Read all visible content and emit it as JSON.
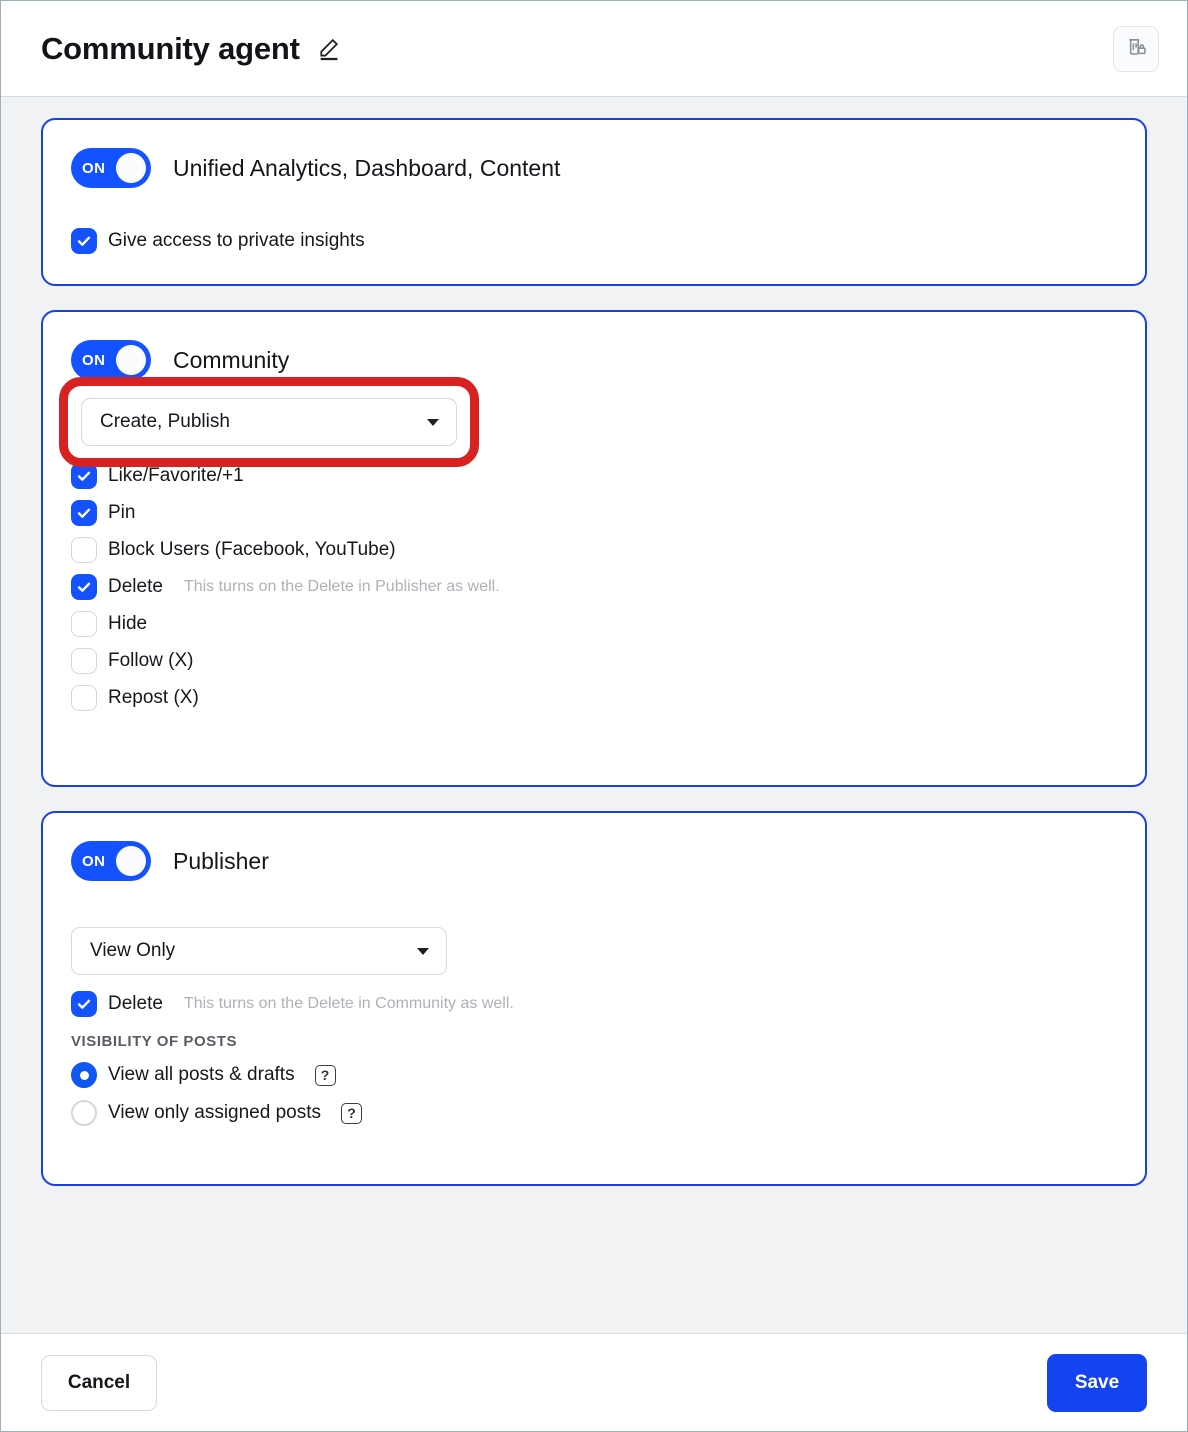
{
  "header": {
    "title": "Community agent",
    "edit_icon": "pencil-icon",
    "delete_icon": "trash-lock-icon"
  },
  "sections": [
    {
      "key": "analytics",
      "toggle_label": "ON",
      "title": "Unified Analytics, Dashboard, Content",
      "checkboxes": [
        {
          "label": "Give access to private insights",
          "checked": true,
          "hint": ""
        }
      ]
    },
    {
      "key": "community",
      "toggle_label": "ON",
      "title": "Community",
      "dropdown": {
        "value": "Create, Publish",
        "caret": "chevron-down-icon",
        "highlighted": true
      },
      "checkboxes": [
        {
          "label": "Like/Favorite/+1",
          "checked": true,
          "hint": ""
        },
        {
          "label": "Pin",
          "checked": true,
          "hint": ""
        },
        {
          "label": "Block Users (Facebook, YouTube)",
          "checked": false,
          "hint": ""
        },
        {
          "label": "Delete",
          "checked": true,
          "hint": "This turns on the Delete in Publisher as well."
        },
        {
          "label": "Hide",
          "checked": false,
          "hint": ""
        },
        {
          "label": "Follow (X)",
          "checked": false,
          "hint": ""
        },
        {
          "label": "Repost (X)",
          "checked": false,
          "hint": ""
        }
      ]
    },
    {
      "key": "publisher",
      "toggle_label": "ON",
      "title": "Publisher",
      "dropdown": {
        "value": "View Only",
        "caret": "chevron-down-icon",
        "highlighted": false
      },
      "checkboxes": [
        {
          "label": "Delete",
          "checked": true,
          "hint": "This turns on the Delete in Community as well."
        }
      ],
      "group_label": "VISIBILITY OF POSTS",
      "radios": [
        {
          "label": "View all posts & drafts",
          "selected": true,
          "help": "?"
        },
        {
          "label": "View only assigned posts",
          "selected": false,
          "help": "?"
        }
      ]
    }
  ],
  "footer": {
    "cancel_label": "Cancel",
    "save_label": "Save"
  },
  "colors": {
    "accent_blue": "#1452ff",
    "card_border": "#1a41e0",
    "highlight_red": "#d72222",
    "save_blue": "#1344f0",
    "hint_gray": "#adb1b8"
  }
}
